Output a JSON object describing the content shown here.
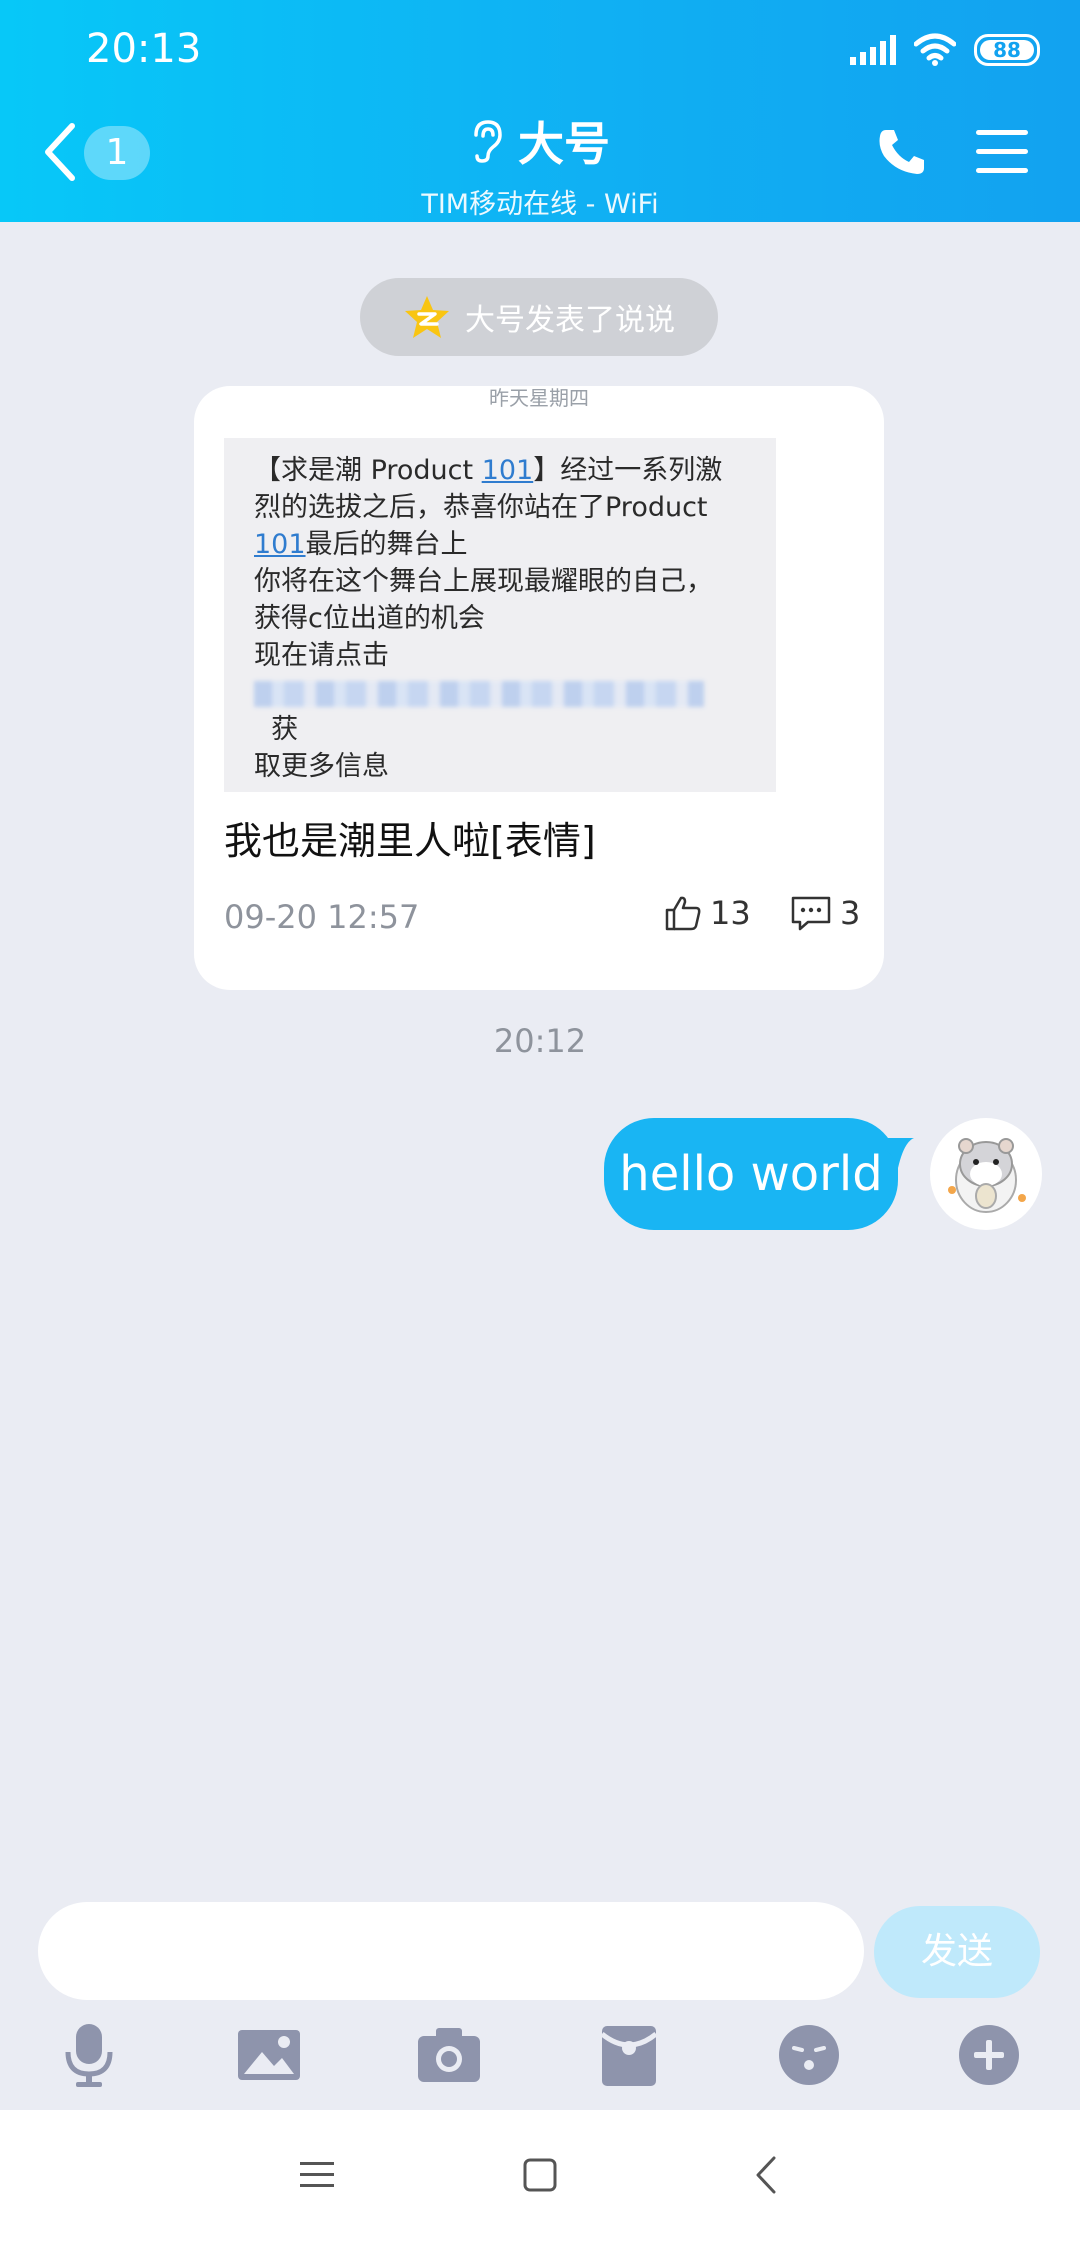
{
  "status_bar": {
    "time": "20:13",
    "battery": "88"
  },
  "header": {
    "back_badge": "1",
    "title": "大号",
    "subtitle": "TIM移动在线 - WiFi"
  },
  "notice": {
    "text": "大号发表了说说"
  },
  "card": {
    "tiny_label": "昨天星期四",
    "image_text": {
      "l1a": "【求是潮 Product ",
      "l1link": "101",
      "l1b": "】经过一系列激",
      "l2": "烈的选拔之后，恭喜你站在了Product",
      "l3link": "101",
      "l3b": "最后的舞台上",
      "l4": "你将在这个舞台上展现最耀眼的自己，",
      "l5": "获得c位出道的机会",
      "l6": "现在请点击",
      "l7end": "获",
      "l8": "取更多信息"
    },
    "caption": "我也是潮里人啦[表情]",
    "timestamp": "09-20 12:57",
    "likes": "13",
    "comments": "3"
  },
  "chat": {
    "time_divider": "20:12",
    "message": "hello world"
  },
  "input": {
    "placeholder": "",
    "send_label": "发送"
  },
  "icons": {
    "toolbar": [
      "microphone-icon",
      "image-icon",
      "camera-icon",
      "red-packet-icon",
      "emoji-icon",
      "plus-icon"
    ],
    "nav": [
      "menu-icon",
      "home-icon",
      "back-icon"
    ]
  },
  "colors": {
    "header_start": "#07c8f8",
    "header_end": "#12a2f0",
    "bubble": "#19b5f3",
    "background": "#eaecf3",
    "send_button": "#bfe9fb"
  }
}
